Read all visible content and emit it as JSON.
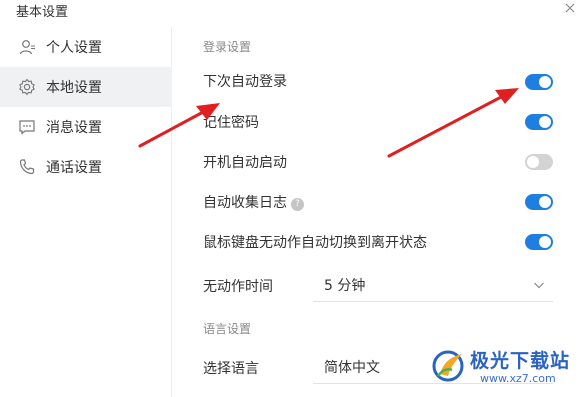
{
  "window": {
    "title": "基本设置"
  },
  "sidebar": {
    "items": [
      {
        "label": "个人设置",
        "icon": "user-icon",
        "active": false
      },
      {
        "label": "本地设置",
        "icon": "gear-icon",
        "active": true
      },
      {
        "label": "消息设置",
        "icon": "chat-icon",
        "active": false
      },
      {
        "label": "通话设置",
        "icon": "phone-icon",
        "active": false
      }
    ]
  },
  "login_settings": {
    "section_title": "登录设置",
    "rows": [
      {
        "label": "下次自动登录",
        "enabled": true
      },
      {
        "label": "记住密码",
        "enabled": true
      },
      {
        "label": "开机自动启动",
        "enabled": false
      },
      {
        "label": "自动收集日志",
        "enabled": true,
        "help_icon": "?"
      },
      {
        "label": "鼠标键盘无动作自动切换到离开状态",
        "enabled": true
      }
    ],
    "idle_time": {
      "label": "无动作时间",
      "value": "5 分钟"
    }
  },
  "language_settings": {
    "section_title": "语言设置",
    "language": {
      "label": "选择语言",
      "value": "简体中文"
    }
  },
  "annotations": {
    "arrow_color": "#e02020"
  },
  "colors": {
    "toggle_on": "#1f7ee1",
    "toggle_off": "#d3d3d3",
    "sidebar_active": "#f0f1f3"
  },
  "watermark": {
    "text": "极光下载站",
    "url": "www.xz7.com"
  }
}
